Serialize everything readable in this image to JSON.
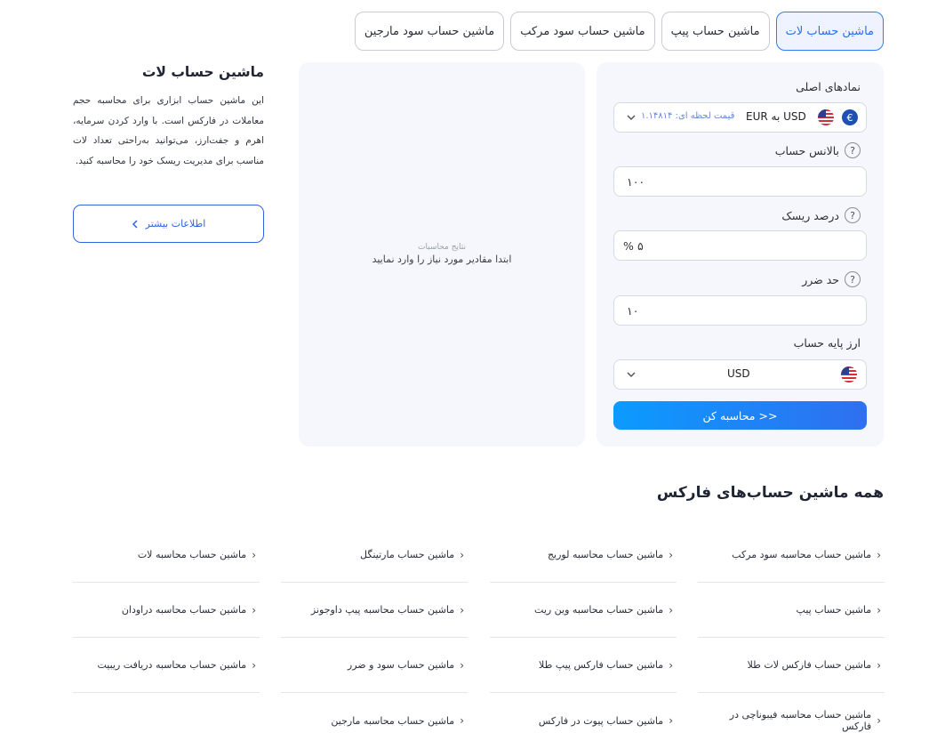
{
  "tabs": [
    {
      "label": "ماشین حساب لات",
      "active": true
    },
    {
      "label": "ماشین حساب پیپ",
      "active": false
    },
    {
      "label": "ماشین حساب سود مرکب",
      "active": false
    },
    {
      "label": "ماشین حساب سود مارجین",
      "active": false
    }
  ],
  "form": {
    "symbols_label": "نمادهای اصلی",
    "pair_value": "EUR به USD",
    "pair_price": "قیمت لحظه ای: ۱.۱۴۸۱۴",
    "balance_label": "بالانس حساب",
    "balance_value": "۱۰۰",
    "risk_label": "درصد ریسک",
    "risk_value": "۵",
    "risk_unit": "%",
    "stoploss_label": "حد ضرر",
    "stoploss_value": "۱۰",
    "base_currency_label": "ارز پایه حساب",
    "base_currency_value": "USD",
    "calculate_label": "محاسبه کن >>",
    "help_glyph": "?"
  },
  "results": {
    "title": "نتایج محاسبات",
    "message": "ابتدا مقادیر مورد نیاز را وارد نمایید"
  },
  "info": {
    "title": "ماشین حساب لات",
    "description": "این ماشین حساب ابزاری برای محاسبه حجم معاملات در فارکس است. با وارد کردن سرمایه، اهرم و جفت‌ارز، می‌توانید به‌راحتی تعداد لات مناسب برای مدیریت ریسک خود را محاسبه کنید.",
    "more_label": "اطلاعات بیشتر"
  },
  "all_calculators": {
    "title": "همه ماشین حساب‌های فارکس",
    "columns": [
      [
        "ماشین حساب محاسبه سود مرکب",
        "ماشین حساب پیپ",
        "ماشین حساب فارکس لات طلا",
        "ماشین حساب محاسبه فیبوناچی در فارکس"
      ],
      [
        "ماشین حساب محاسبه لوریج",
        "ماشین حساب محاسبه وین ریت",
        "ماشین حساب فارکس پیپ طلا",
        "ماشین حساب پیوت در فارکس"
      ],
      [
        "ماشین حساب مارتینگل",
        "ماشین حساب محاسبه پیپ داوجونز",
        "ماشین حساب سود و ضرر",
        "ماشین حساب محاسبه مارجین"
      ],
      [
        "ماشین حساب محاسبه لات",
        "ماشین حساب محاسبه دراودان",
        "ماشین حساب محاسبه دریافت ریبیت"
      ]
    ]
  },
  "colors": {
    "accent": "#2f7cf6",
    "card_bg": "#f5f7fc",
    "button_gradient_start": "#0b9bff",
    "button_gradient_end": "#2f6ff0"
  },
  "icons": {
    "pair_icon": "euro-circle-icon",
    "flag_icon": "us-flag-icon",
    "dropdown_icon": "chevron-down-icon",
    "help_icon": "question-circle-icon",
    "link_icon": "chevron-left-icon"
  }
}
